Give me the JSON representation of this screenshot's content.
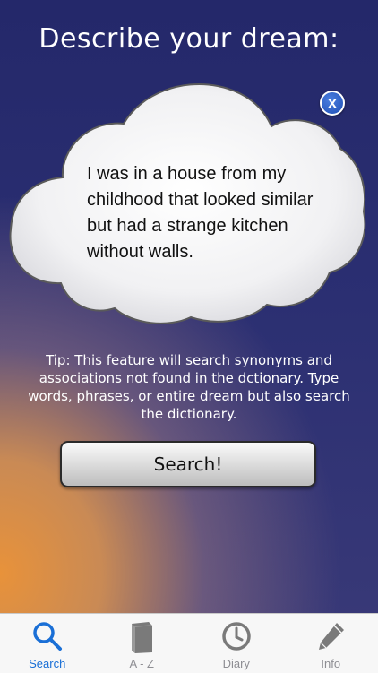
{
  "header": {
    "title": "Describe your dream:"
  },
  "cloud": {
    "dream_text": "I was in a house from my childhood that looked similar but had a strange kitchen without walls.",
    "clear_glyph": "x"
  },
  "tip": {
    "text": "Tip: This feature will search synonyms and associations not found in the dctionary. Type words, phrases, or entire dream but also search the dictionary."
  },
  "actions": {
    "search_label": "Search!"
  },
  "tabbar": {
    "items": [
      {
        "label": "Search",
        "icon": "search-icon",
        "active": true
      },
      {
        "label": "A - Z",
        "icon": "book-icon",
        "active": false
      },
      {
        "label": "Diary",
        "icon": "clock-icon",
        "active": false
      },
      {
        "label": "Info",
        "icon": "pencil-icon",
        "active": false
      }
    ]
  },
  "colors": {
    "accent": "#1a6fd6",
    "background_top": "#24286a",
    "glow": "#e8923a"
  }
}
